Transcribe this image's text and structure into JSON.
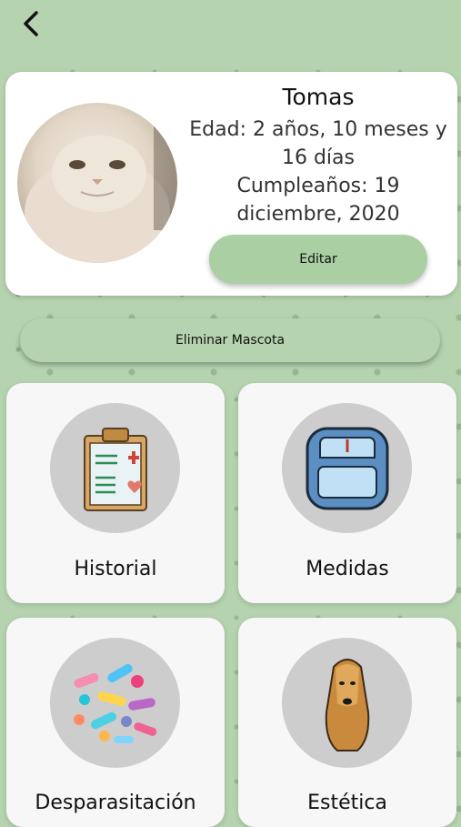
{
  "pet": {
    "name": "Tomas",
    "age_line": "Edad: 2 años, 10 meses y 16 días",
    "birthday_line": "Cumpleaños: 19 diciembre, 2020"
  },
  "actions": {
    "edit_label": "Editar",
    "delete_label": "Eliminar Mascota"
  },
  "tiles": [
    {
      "label": "Historial",
      "icon": "clipboard-icon"
    },
    {
      "label": "Medidas",
      "icon": "scale-icon"
    },
    {
      "label": "Desparasitación",
      "icon": "pills-icon"
    },
    {
      "label": "Estética",
      "icon": "dog-icon"
    }
  ],
  "colors": {
    "background": "#b5d3ae",
    "button": "#a9cfa3",
    "card": "#ffffff",
    "tile": "#f7f7f7"
  }
}
